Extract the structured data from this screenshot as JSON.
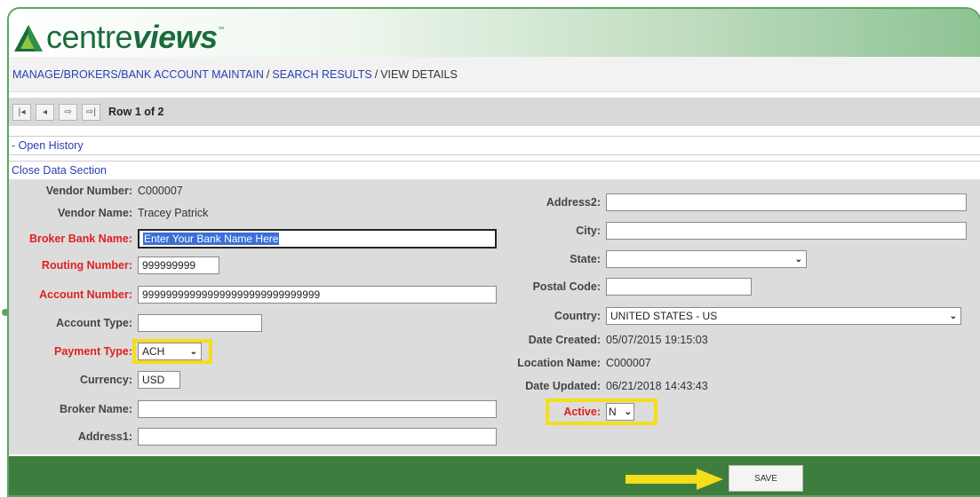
{
  "brand": {
    "logo_prefix": "centre",
    "logo_emph": "views",
    "logo_mark": "™"
  },
  "breadcrumb": {
    "part1": "MANAGE/BROKERS/BANK ACCOUNT MAINTAIN",
    "sep1": "/",
    "part2": "SEARCH RESULTS",
    "sep2": "/",
    "current": "VIEW DETAILS"
  },
  "nav": {
    "first": "|◂",
    "prev": "◂",
    "next": "⇨",
    "last": "⇨|",
    "row_info": "Row 1 of 2"
  },
  "links": {
    "open_history": "- Open History",
    "close_data": "Close Data Section"
  },
  "form": {
    "vendor_number_label": "Vendor Number:",
    "vendor_number": "C000007",
    "vendor_name_label": "Vendor Name:",
    "vendor_name": "Tracey Patrick",
    "broker_bank_name_label": "Broker Bank Name:",
    "broker_bank_name": "Enter Your Bank Name Here",
    "routing_number_label": "Routing Number:",
    "routing_number": "999999999",
    "account_number_label": "Account Number:",
    "account_number": "999999999999999999999999999999",
    "account_type_label": "Account Type:",
    "account_type": "",
    "payment_type_label": "Payment Type:",
    "payment_type": "ACH",
    "currency_label": "Currency:",
    "currency": "USD",
    "broker_name_label": "Broker Name:",
    "broker_name": "",
    "address1_label": "Address1:",
    "address1": "",
    "address2_label": "Address2:",
    "address2": "",
    "city_label": "City:",
    "city": "",
    "state_label": "State:",
    "state": "",
    "postal_code_label": "Postal Code:",
    "postal_code": "",
    "country_label": "Country:",
    "country": "UNITED STATES - US",
    "date_created_label": "Date Created:",
    "date_created": "05/07/2015 19:15:03",
    "location_name_label": "Location Name:",
    "location_name": "C000007",
    "date_updated_label": "Date Updated:",
    "date_updated": "06/21/2018 14:43:43",
    "active_label": "Active:",
    "active": "N"
  },
  "footer": {
    "save_label": "SAVE"
  },
  "colors": {
    "brand_green": "#1a6b3a",
    "footer_green": "#3d7d3d",
    "required_red": "#e02020",
    "highlight_yellow": "#f4dd1a",
    "link_blue": "#2a3fb0"
  }
}
